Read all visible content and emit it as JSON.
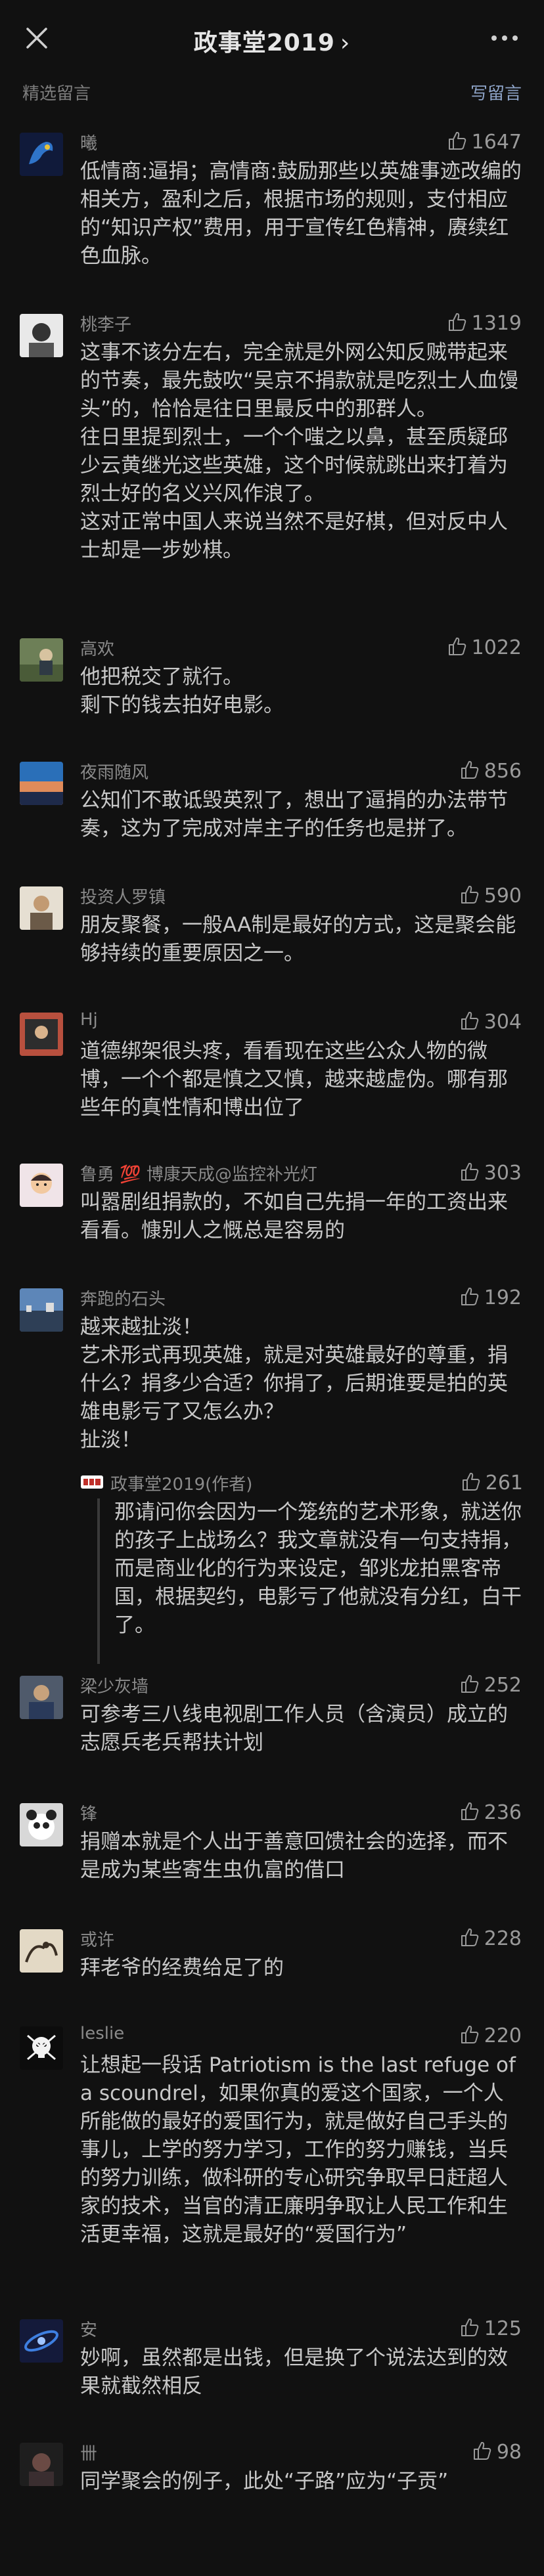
{
  "header": {
    "title": "政事堂2019",
    "chevron": "›"
  },
  "subbar": {
    "left": "精选留言",
    "right": "写留言"
  },
  "comments": [
    {
      "name": "曦",
      "likes": "1647",
      "content": "低情商:逼捐；高情商:鼓励那些以英雄事迹改编的相关方，盈利之后，根据市场的规则，支付相应的“知识产权”费用，用于宣传红色精神，赓续红色血脉。"
    },
    {
      "name": "桃李子",
      "likes": "1319",
      "content": "这事不该分左右，完全就是外网公知反贼带起来的节奏，最先鼓吹“吴京不捐款就是吃烈士人血馒头”的，恰恰是往日里最反中的那群人。\n往日里提到烈士，一个个嗤之以鼻，甚至质疑邱少云黄继光这些英雄，这个时候就跳出来打着为烈士好的名义兴风作浪了。\n这对正常中国人来说当然不是好棋，但对反中人士却是一步妙棋。"
    },
    {
      "name": "高欢",
      "likes": "1022",
      "content": "他把税交了就行。\n剩下的钱去拍好电影。"
    },
    {
      "name": "夜雨随风",
      "likes": "856",
      "content": "公知们不敢诋毁英烈了，想出了逼捐的办法带节奏，这为了完成对岸主子的任务也是拼了。"
    },
    {
      "name": "投资人罗镇",
      "likes": "590",
      "content": "朋友聚餐，一般AA制是最好的方式，这是聚会能够持续的重要原因之一。"
    },
    {
      "name": "Hj",
      "likes": "304",
      "content": "道德绑架很头疼，看看现在这些公众人物的微博，一个个都是慎之又慎，越来越虚伪。哪有那些年的真性情和博出位了"
    },
    {
      "name": "鲁勇 💯 博康天成@监控补光灯",
      "likes": "303",
      "content": "叫嚣剧组捐款的，不如自己先捐一年的工资出来看看。慷别人之慨总是容易的"
    },
    {
      "name": "奔跑的石头",
      "likes": "192",
      "content": "越来越扯淡！\n艺术形式再现英雄，就是对英雄最好的尊重，捐什么？捐多少合适？你捐了，后期谁要是拍的英雄电影亏了又怎么办？\n扯淡！"
    },
    {
      "name": "梁少灰墙",
      "likes": "252",
      "content": "可参考三八线电视剧工作人员（含演员）成立的志愿兵老兵帮扶计划"
    },
    {
      "name": "锋",
      "likes": "236",
      "content": "捐赠本就是个人出于善意回馈社会的选择，而不是成为某些寄生虫仇富的借口"
    },
    {
      "name": "或许",
      "likes": "228",
      "content": "拜老爷的经费给足了的"
    },
    {
      "name": "leslie",
      "likes": "220",
      "content": "让想起一段话 Patriotism is the last refuge of a scoundrel，如果你真的爱这个国家，一个人所能做的最好的爱国行为，就是做好自己手头的事儿，上学的努力学习，工作的努力赚钱，当兵的努力训练，做科研的专心研究争取早日赶超人家的技术，当官的清正廉明争取让人民工作和生活更幸福，这就是最好的“爱国行为”"
    },
    {
      "name": "安",
      "likes": "125",
      "content": "妙啊，虽然都是出钱，但是换了个说法达到的效果就截然相反"
    },
    {
      "name": "卌",
      "likes": "98",
      "content": "同学聚会的例子，此处“子路”应为“子贡”"
    }
  ],
  "author_reply": {
    "name": "政事堂2019(作者)",
    "likes": "261",
    "content": "那请问你会因为一个笼统的艺术形象，就送你的孩子上战场么？我文章就没有一句支持捐，而是商业化的行为来设定，邹兆龙拍黑客帝国，根据契约，电影亏了他就没有分红，白干了。"
  },
  "colors": {
    "background": "#111111",
    "text": "#c8c8c8",
    "muted": "#8a8a8a",
    "link": "#8ea4c8"
  },
  "icons": [
    "close-icon",
    "chevron-right-icon",
    "more-icon",
    "thumb-up-icon"
  ]
}
